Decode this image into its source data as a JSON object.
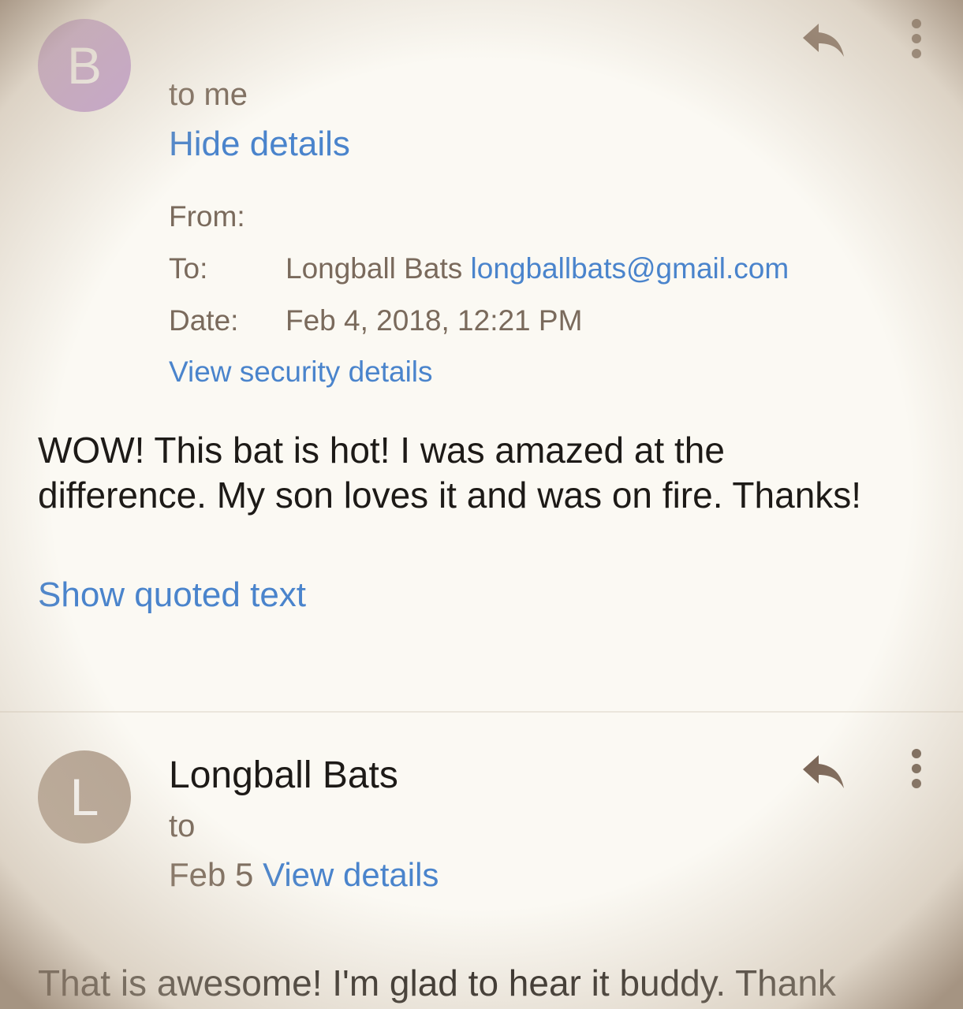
{
  "message1": {
    "avatar_letter": "B",
    "avatar_color": "#c7a3d6",
    "recipient": "to me",
    "hide_details": "Hide details",
    "from_label": "From:",
    "to_label": "To:",
    "to_name": "Longball Bats",
    "to_email": "longballbats@gmail.com",
    "date_label": "Date:",
    "date_value": "Feb 4, 2018, 12:21 PM",
    "security_link": "View security details",
    "body_line1": "WOW! This bat is hot! I was amazed at the",
    "body_line2": "difference. My son loves it and was on fire. Thanks!",
    "show_quoted": "Show quoted text"
  },
  "message2": {
    "avatar_letter": "L",
    "avatar_color": "#b6a595",
    "sender": "Longball Bats",
    "recipient": "to",
    "date": "Feb 5",
    "view_details": "View details",
    "body_line1": "That is awesome! I'm glad to hear it buddy. Thank"
  },
  "icons": {
    "reply": "reply-arrow-icon",
    "more": "more-vertical-icon"
  },
  "colors": {
    "link": "#4a84cc",
    "icon": "#7b6657"
  }
}
